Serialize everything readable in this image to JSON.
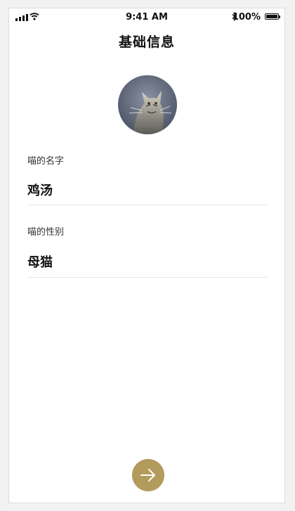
{
  "status_bar": {
    "time": "9:41 AM",
    "battery_percent": "100%",
    "icons": [
      "signal-icon",
      "wifi-icon",
      "bluetooth-icon",
      "battery-icon"
    ]
  },
  "header": {
    "title": "基础信息"
  },
  "avatar": {
    "description_icon": "cat-avatar"
  },
  "form": {
    "name": {
      "label": "喵的名字",
      "value": "鸡汤"
    },
    "gender": {
      "label": "喵的性别",
      "value": "母猫"
    }
  },
  "actions": {
    "next_icon": "arrow-right-icon"
  },
  "colors": {
    "accent": "#b39b5c",
    "divider": "#e6e6e6",
    "text": "#111111"
  }
}
